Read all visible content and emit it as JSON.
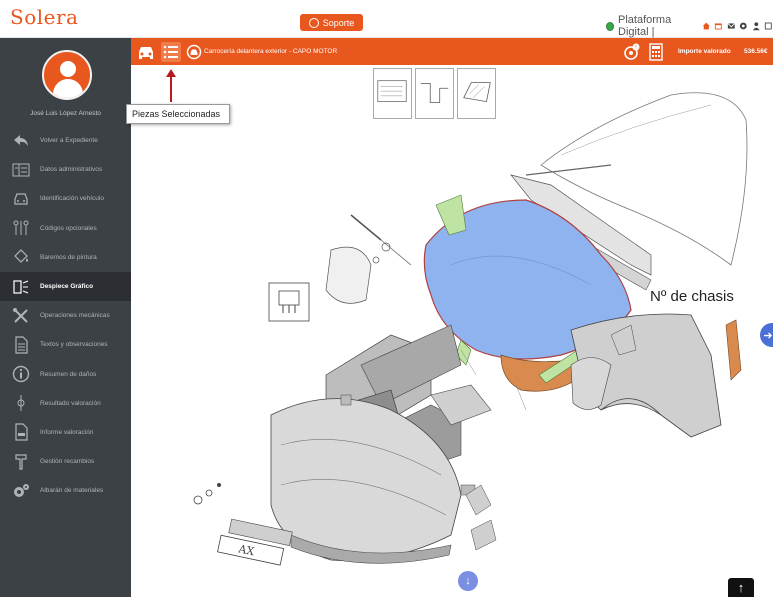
{
  "header": {
    "logo": "Solera",
    "support_label": "Soporte",
    "platform_label": "Plataforma Digital |"
  },
  "sidebar": {
    "user_name": "José Luis López Arnesto",
    "items": [
      {
        "label": "Volver a Expediente",
        "icon": "back-arrow-icon"
      },
      {
        "label": "Datos administrativos",
        "icon": "form-icon"
      },
      {
        "label": "Identificación vehículo",
        "icon": "car-front-icon"
      },
      {
        "label": "Códigos opcionales",
        "icon": "options-icon"
      },
      {
        "label": "Baremos de pintura",
        "icon": "paint-bucket-icon"
      },
      {
        "label": "Despiece Gráfico",
        "icon": "exploded-view-icon",
        "active": true
      },
      {
        "label": "Operaciones mecánicas",
        "icon": "wrench-screwdriver-icon"
      },
      {
        "label": "Textos y observaciones",
        "icon": "document-icon"
      },
      {
        "label": "Resumen de daños",
        "icon": "info-icon"
      },
      {
        "label": "Resultado valoración",
        "icon": "gauge-icon"
      },
      {
        "label": "Informe valoración",
        "icon": "pdf-icon"
      },
      {
        "label": "Gestión recambios",
        "icon": "parts-icon"
      },
      {
        "label": "Albarán de materiales",
        "icon": "gears-icon"
      }
    ]
  },
  "toolbar": {
    "breadcrumb": "Carrocería delantera exterior - CAPO MOTOR",
    "amount_label": "Importe valorado",
    "amount_value": "536.56€"
  },
  "tooltip": {
    "text": "Piezas Seleccionadas"
  },
  "diagram": {
    "annotation": "Nº de chasis",
    "plate_text": "AX"
  },
  "colors": {
    "accent": "#e8571e",
    "sidebar_bg": "#3c4146",
    "selected_part": "#8fb3ef",
    "highlight_part": "#d98a4e"
  }
}
